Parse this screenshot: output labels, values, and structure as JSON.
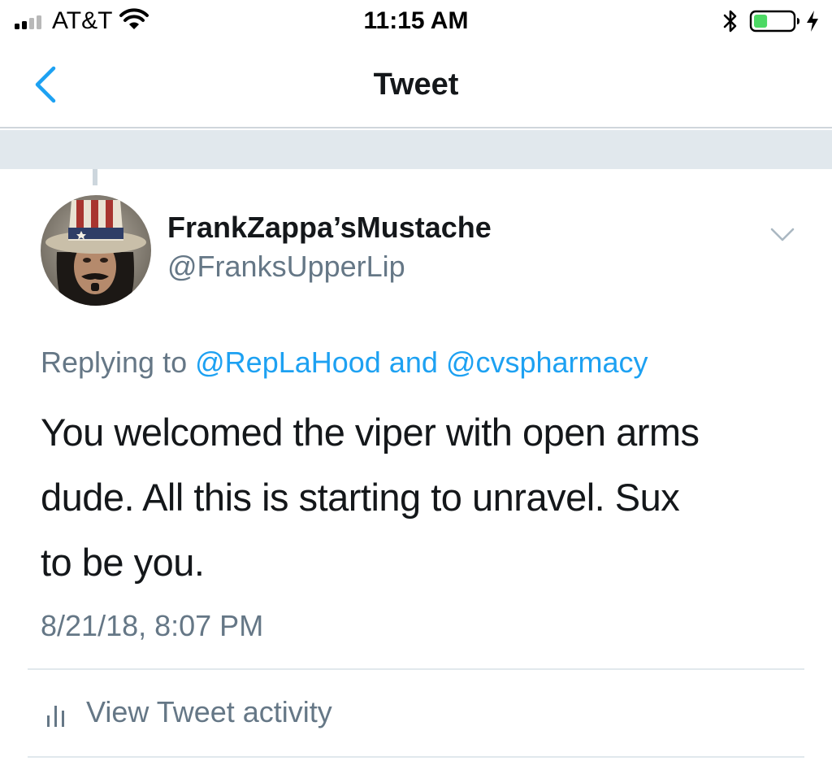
{
  "status_bar": {
    "carrier": "AT&T",
    "time": "11:15 AM",
    "signal_bars_filled": 2,
    "signal_bars_total": 4,
    "battery_level": 0.35,
    "battery_color": "#4cd964",
    "icons": [
      "signal-icon",
      "wifi-icon",
      "bluetooth-icon",
      "battery-icon",
      "charging-icon"
    ]
  },
  "nav": {
    "title": "Tweet",
    "back_icon": "chevron-left-icon"
  },
  "tweet": {
    "display_name": "FrankZappa’sMustache",
    "username": "@FranksUpperLip",
    "replying_prefix": "Replying to",
    "reply_mentions": [
      "@RepLaHood",
      "@cvspharmacy"
    ],
    "reply_conjunction": "and",
    "text_lines": [
      "You welcomed the viper with open arms",
      "dude.  All this is starting to unravel.  Sux",
      "to be you."
    ],
    "timestamp": "8/21/18, 8:07 PM",
    "caret_icon": "chevron-down-icon"
  },
  "activity": {
    "label": "View Tweet activity",
    "icon": "bar-chart-icon"
  },
  "colors": {
    "accent": "#1da1f2",
    "secondary_text": "#657786",
    "primary_text": "#14171a",
    "separator": "#e1e8ed"
  }
}
